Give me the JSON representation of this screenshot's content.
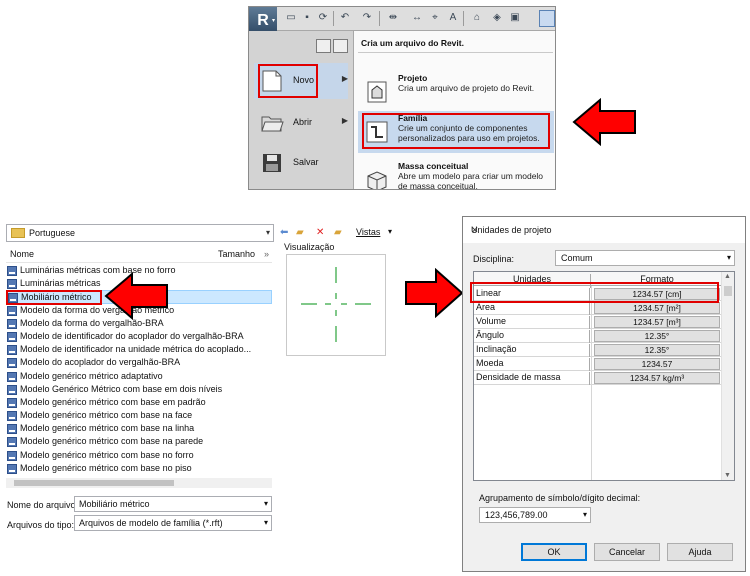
{
  "revit_menu": {
    "app_letter": "R",
    "items": [
      {
        "label": "Novo"
      },
      {
        "label": "Abrir"
      },
      {
        "label": "Salvar"
      }
    ],
    "submenu": {
      "title": "Cria um arquivo do Revit.",
      "items": [
        {
          "title": "Projeto",
          "desc": "Cria um arquivo de projeto do Revit."
        },
        {
          "title": "Família",
          "desc": "Crie um conjunto de componentes personalizados para uso em projetos."
        },
        {
          "title": "Massa conceitual",
          "desc": "Abre um modelo para criar um modelo de massa conceitual."
        }
      ]
    }
  },
  "file_browser": {
    "folder": "Portuguese",
    "columns": {
      "name": "Nome",
      "size": "Tamanho"
    },
    "files": [
      "Luminárias métricas com base no forro",
      "Luminárias métricas",
      "Mobiliário métrico",
      "Modelo da forma do vergalhão métrico",
      "Modelo da forma do vergalhão-BRA",
      "Modelo de identificador do acoplador do vergalhão-BRA",
      "Modelo de identificador na unidade métrica do acoplado...",
      "Modelo do acoplador do vergalhão-BRA",
      "Modelo genérico métrico adaptativo",
      "Modelo Genérico Métrico com base em dois níveis",
      "Modelo genérico métrico com base em padrão",
      "Modelo genérico métrico com base na face",
      "Modelo genérico métrico com base na linha",
      "Modelo genérico métrico com base na parede",
      "Modelo genérico métrico com base no forro",
      "Modelo genérico métrico com base no piso"
    ],
    "selected_index": 2,
    "file_name_label": "Nome do arquivo:",
    "file_name_value": "Mobiliário métrico",
    "file_type_label": "Arquivos do tipo:",
    "file_type_value": "Arquivos de modelo de família  (*.rft)",
    "views_label": "Vistas",
    "preview_label": "Visualização"
  },
  "units_dialog": {
    "title": "Unidades de projeto",
    "discipline_label": "Disciplina:",
    "discipline_value": "Comum",
    "headers": {
      "units": "Unidades",
      "format": "Formato"
    },
    "rows": [
      {
        "name": "Linear",
        "format": "1234.57 [cm]"
      },
      {
        "name": "Área",
        "format": "1234.57 [m²]"
      },
      {
        "name": "Volume",
        "format": "1234.57 [m³]"
      },
      {
        "name": "Ângulo",
        "format": "12.35°"
      },
      {
        "name": "Inclinação",
        "format": "12.35°"
      },
      {
        "name": "Moeda",
        "format": "1234.57"
      },
      {
        "name": "Densidade de massa",
        "format": "1234.57 kg/m³"
      }
    ],
    "grouping_label": "Agrupamento de símbolo/dígito decimal:",
    "grouping_value": "123,456,789.00",
    "buttons": {
      "ok": "OK",
      "cancel": "Cancelar",
      "help": "Ajuda"
    }
  },
  "colors": {
    "highlight_red": "#e10000",
    "selection_blue": "#c7d9ee"
  }
}
